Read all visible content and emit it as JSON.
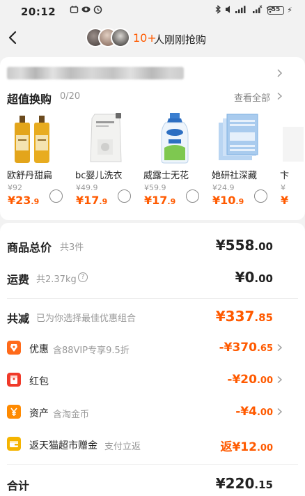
{
  "status": {
    "time": "20:12",
    "battery": "55"
  },
  "header": {
    "count": "10+",
    "text": "人刚刚抢购"
  },
  "trade_in": {
    "title": "超值换购",
    "count": "0/20",
    "view_all": "查看全部",
    "products": [
      {
        "name": "欧舒丹甜扁",
        "old_price": "¥92",
        "price_int": "¥23",
        "price_dec": ".9"
      },
      {
        "name": "bc婴儿洗衣",
        "old_price": "¥49.9",
        "price_int": "¥17",
        "price_dec": ".9"
      },
      {
        "name": "威露士无花",
        "old_price": "¥59.9",
        "price_int": "¥17",
        "price_dec": ".9"
      },
      {
        "name": "她研社深藏",
        "old_price": "¥24.9",
        "price_int": "¥10",
        "price_dec": ".9"
      },
      {
        "name": "卞",
        "old_price": "¥",
        "price_int": "¥",
        "price_dec": ""
      }
    ]
  },
  "summary": {
    "goods_total": {
      "label": "商品总价",
      "sub": "共3件",
      "int": "¥558",
      "dec": ".00"
    },
    "shipping": {
      "label": "运费",
      "sub": "共2.37kg",
      "help": "?",
      "int": "¥0",
      "dec": ".00"
    },
    "discount": {
      "label": "共减",
      "sub": "已为你选择最佳优惠组合",
      "int": "¥337",
      "dec": ".85"
    },
    "items": [
      {
        "label": "优惠",
        "sub": "含88VIP专享9.5折",
        "int": "-¥370",
        "dec": ".65",
        "chevron": true
      },
      {
        "label": "红包",
        "sub": "",
        "int": "-¥20",
        "dec": ".00",
        "chevron": true
      },
      {
        "label": "资产",
        "sub": "含淘金币",
        "int": "-¥4",
        "dec": ".00",
        "chevron": true
      },
      {
        "label": "返天猫超市赠金",
        "sub": "支付立返",
        "int": "返¥12",
        "dec": ".00",
        "chevron": false
      }
    ],
    "total": {
      "label": "合计",
      "int": "¥220",
      "dec": ".15"
    }
  },
  "colors": {
    "accent": "#ff5a00",
    "coupon_icon": "#ff6a1a",
    "redpacket_icon": "#f03a2a",
    "asset_icon": "#ff8a00",
    "return_icon": "#f5b400"
  },
  "icons": [
    "back-arrow-icon",
    "coupon-icon",
    "red-packet-icon",
    "yen-asset-icon",
    "wallet-icon",
    "chevron-right-icon"
  ]
}
